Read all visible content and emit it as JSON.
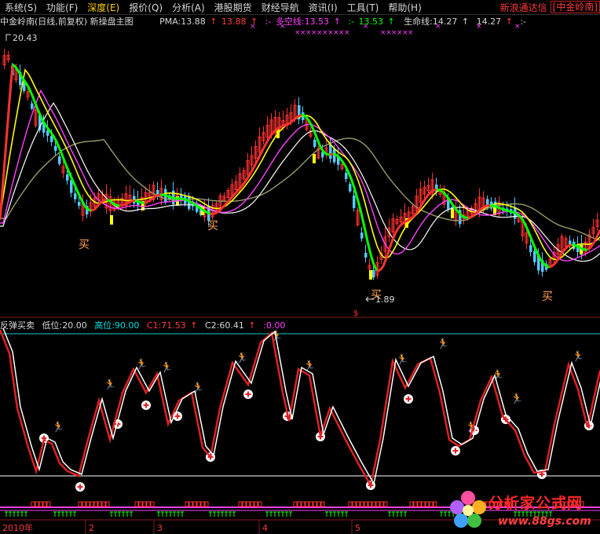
{
  "menu": {
    "items": [
      {
        "label": "系统",
        "key": "(S)"
      },
      {
        "label": "功能",
        "key": "(F)"
      },
      {
        "label": "深度",
        "key": "(E)",
        "active": true
      },
      {
        "label": "报价",
        "key": "(Q)"
      },
      {
        "label": "分析",
        "key": "(A)"
      },
      {
        "label": "港股期货",
        "key": ""
      },
      {
        "label": "财经导航",
        "key": ""
      },
      {
        "label": "资讯",
        "key": "(I)"
      },
      {
        "label": "工具",
        "key": "(T)"
      },
      {
        "label": "帮助",
        "key": "(H)"
      }
    ],
    "brand_name": "新浪通达信",
    "brand_box": "[中金岭南]"
  },
  "main_panel": {
    "title": "中金岭南(日线,前复权) 新操盘主图",
    "pma_label": "PMA:13.88",
    "pma_value": "13.88",
    "sep1": ":-",
    "duokong_label": "多空线:13.53",
    "sep2": ":-",
    "duokong_value": "13.53",
    "life_label": "生命线:14.27",
    "life_value": "14.27",
    "sep3": ":-",
    "high_price": "20.43",
    "low_price": "1.89",
    "buy_marks": [
      "买",
      "买",
      "买",
      "买"
    ]
  },
  "sub_panel": {
    "title": "反弹买卖",
    "low_label": "低位:20.00",
    "high_label": "高位:90.00",
    "c1_label": "C1:71.53",
    "c2_label": "C2:60.41",
    "extra": ":0.00"
  },
  "time_axis": {
    "labels": [
      "2010年",
      "2",
      "3",
      "4",
      "5"
    ]
  },
  "watermark": {
    "title": "分析家公式网",
    "url": "www.88gs.com"
  },
  "colors": {
    "up": "#ff3232",
    "down": "#54c8ff",
    "yellow": "#ffff00",
    "green": "#00ff00",
    "magenta": "#ff40ff",
    "olive": "#9a9a6a",
    "white": "#ffffff",
    "cyan": "#00e0e0"
  },
  "chart_data": {
    "type": "candlestick",
    "title": "中金岭南(日线,前复权) 新操盘主图",
    "price_high": 20.43,
    "price_low": 1.89,
    "series": [
      {
        "name": "PMA",
        "last": 13.88
      },
      {
        "name": "多空线",
        "last": 13.53
      },
      {
        "name": "生命线",
        "last": 14.27
      }
    ],
    "sub_indicator": {
      "name": "反弹买卖",
      "series": [
        {
          "name": "C1",
          "last": 71.53
        },
        {
          "name": "C2",
          "last": 60.41
        }
      ],
      "levels": {
        "低位": 20.0,
        "高位": 90.0
      }
    },
    "x_labels": [
      "2010年",
      "2",
      "3",
      "4",
      "5"
    ]
  }
}
